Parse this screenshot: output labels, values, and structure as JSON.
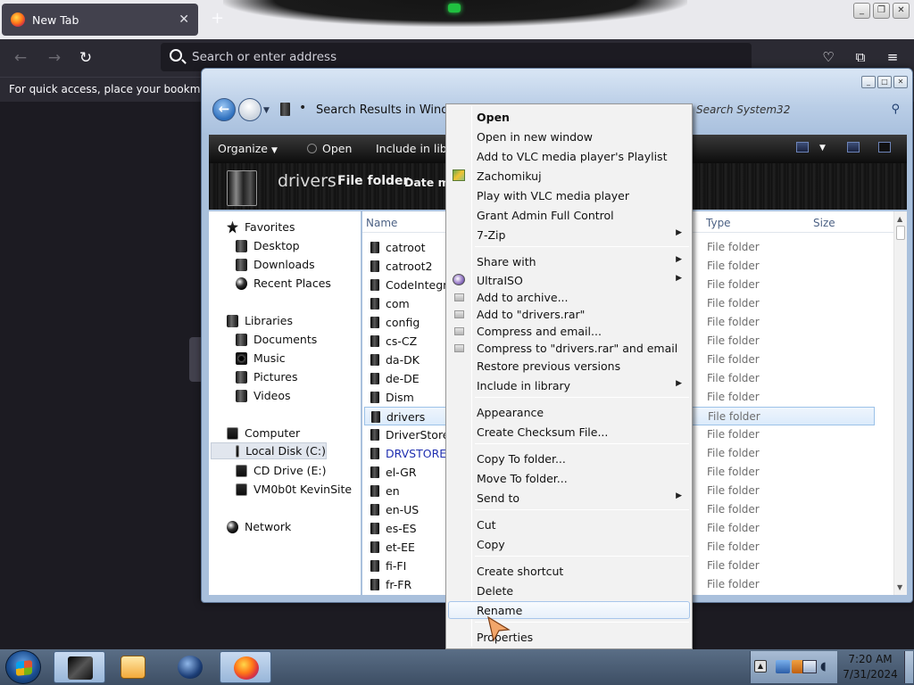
{
  "browser": {
    "tab_title": "New Tab",
    "tab_close": "✕",
    "new_tab": "+",
    "address_placeholder": "Search or enter address",
    "bookmarks_hint": "For quick access, place your bookmarks h"
  },
  "explorer": {
    "address_text": "Search Results in Windo",
    "search_placeholder": "Search System32",
    "toolbar": {
      "organize": "Organize",
      "open": "Open",
      "include": "Include in libra"
    },
    "details": {
      "name": "drivers",
      "type": "File folder",
      "date": "Date m"
    },
    "nav": {
      "favorites": "Favorites",
      "desktop": "Desktop",
      "downloads": "Downloads",
      "recent_places": "Recent Places",
      "libraries": "Libraries",
      "documents": "Documents",
      "music": "Music",
      "pictures": "Pictures",
      "videos": "Videos",
      "computer": "Computer",
      "local_disk": "Local Disk (C:)",
      "cd_drive": "CD Drive (E:)",
      "vm_site": "VM0b0t KevinSite",
      "network": "Network"
    },
    "columns": {
      "name": "Name",
      "type": "Type",
      "size": "Size"
    },
    "files": [
      {
        "name": "catroot",
        "type": "File folder"
      },
      {
        "name": "catroot2",
        "type": "File folder"
      },
      {
        "name": "CodeIntegrity",
        "type": "File folder"
      },
      {
        "name": "com",
        "type": "File folder"
      },
      {
        "name": "config",
        "type": "File folder"
      },
      {
        "name": "cs-CZ",
        "type": "File folder"
      },
      {
        "name": "da-DK",
        "type": "File folder"
      },
      {
        "name": "de-DE",
        "type": "File folder"
      },
      {
        "name": "Dism",
        "type": "File folder"
      },
      {
        "name": "drivers",
        "type": "File folder"
      },
      {
        "name": "DriverStore",
        "type": "File folder"
      },
      {
        "name": "DRVSTORE",
        "type": "File folder"
      },
      {
        "name": "el-GR",
        "type": "File folder"
      },
      {
        "name": "en",
        "type": "File folder"
      },
      {
        "name": "en-US",
        "type": "File folder"
      },
      {
        "name": "es-ES",
        "type": "File folder"
      },
      {
        "name": "et-EE",
        "type": "File folder"
      },
      {
        "name": "fi-FI",
        "type": "File folder"
      },
      {
        "name": "fr-FR",
        "type": "File folder"
      }
    ]
  },
  "context_menu": {
    "open": "Open",
    "open_new_window": "Open in new window",
    "vlc_playlist": "Add to VLC media player's Playlist",
    "zachomikuj": "Zachomikuj",
    "vlc_play": "Play with VLC media player",
    "grant_admin": "Grant Admin Full Control",
    "seven_zip": "7-Zip",
    "share_with": "Share with",
    "ultraiso": "UltraISO",
    "add_archive": "Add to archive...",
    "add_drivers_rar": "Add to \"drivers.rar\"",
    "compress_email": "Compress and email...",
    "compress_rar_email": "Compress to \"drivers.rar\" and email",
    "restore_versions": "Restore previous versions",
    "include_library": "Include in library",
    "appearance": "Appearance",
    "checksum": "Create Checksum File...",
    "copy_to": "Copy To folder...",
    "move_to": "Move To folder...",
    "send_to": "Send to",
    "cut": "Cut",
    "copy": "Copy",
    "create_shortcut": "Create shortcut",
    "delete": "Delete",
    "rename": "Rename",
    "properties": "Properties"
  },
  "taskbar": {
    "time": "7:20 AM",
    "date": "7/31/2024"
  }
}
